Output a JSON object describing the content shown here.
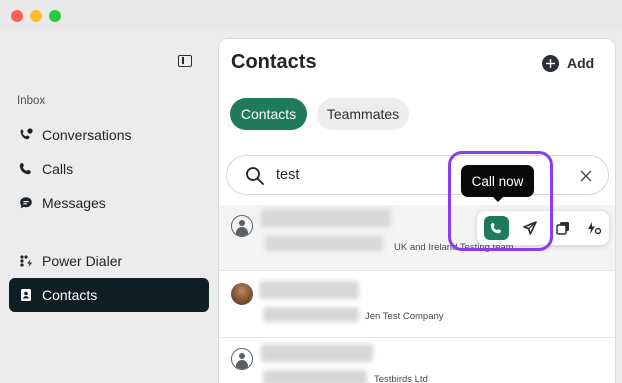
{
  "sidebar": {
    "section_label": "Inbox",
    "items": [
      {
        "label": "Conversations",
        "icon": "conversations-icon"
      },
      {
        "label": "Calls",
        "icon": "phone-icon"
      },
      {
        "label": "Messages",
        "icon": "message-icon"
      },
      {
        "label": "Power Dialer",
        "icon": "power-dialer-icon"
      },
      {
        "label": "Contacts",
        "icon": "contacts-icon",
        "active": true
      }
    ]
  },
  "main": {
    "title": "Contacts",
    "add_label": "Add",
    "tabs": [
      {
        "label": "Contacts",
        "active": true
      },
      {
        "label": "Teammates",
        "active": false
      }
    ],
    "search": {
      "value": "test"
    },
    "contacts": [
      {
        "company": "UK and Ireland Testing team"
      },
      {
        "company": "Jen Test Company"
      },
      {
        "company": "Testbirds Ltd"
      }
    ],
    "tooltip": "Call now"
  },
  "colors": {
    "accent": "#1f7a5c",
    "active_nav": "#0f1e22",
    "highlight": "#8b3cf0"
  }
}
